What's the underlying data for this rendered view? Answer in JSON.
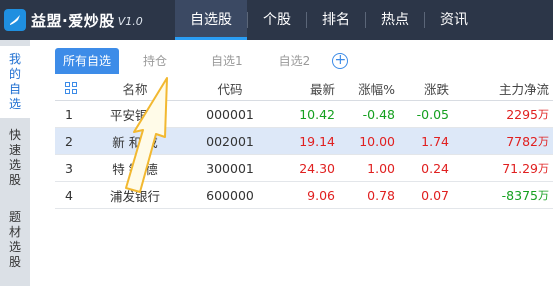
{
  "app": {
    "name": "益盟·爱炒股",
    "version": "V1.0"
  },
  "top_nav": [
    {
      "label": "自选股",
      "active": true
    },
    {
      "label": "个股",
      "active": false
    },
    {
      "label": "排名",
      "active": false
    },
    {
      "label": "热点",
      "active": false
    },
    {
      "label": "资讯",
      "active": false
    }
  ],
  "sidebar": [
    {
      "chars": [
        "我",
        "的",
        "自",
        "选"
      ],
      "active": true
    },
    {
      "chars": [
        "快",
        "速",
        "选",
        "股"
      ],
      "active": false
    },
    {
      "chars": [
        "题",
        "材",
        "选",
        "股"
      ],
      "active": false
    }
  ],
  "tabs": [
    {
      "label": "所有自选",
      "active": true
    },
    {
      "label": "持仓",
      "active": false
    },
    {
      "label": "自选1",
      "active": false
    },
    {
      "label": "自选2",
      "active": false
    }
  ],
  "add_tab_icon": "plus-circle-icon",
  "table": {
    "columns": [
      "名称",
      "代码",
      "最新",
      "涨幅%",
      "涨跌",
      "主力净流"
    ],
    "rows": [
      {
        "idx": "1",
        "name": "平安银行",
        "code": "000001",
        "price": "10.42",
        "pct": "-0.48",
        "chg": "-0.05",
        "flow": "2295",
        "unit": "万",
        "dir": "down",
        "flow_dir": "up",
        "selected": false
      },
      {
        "idx": "2",
        "name": "新 和 成",
        "code": "002001",
        "price": "19.14",
        "pct": "10.00",
        "chg": "1.74",
        "flow": "7782",
        "unit": "万",
        "dir": "up",
        "flow_dir": "up",
        "selected": true
      },
      {
        "idx": "3",
        "name": "特 锐 德",
        "code": "300001",
        "price": "24.30",
        "pct": "1.00",
        "chg": "0.24",
        "flow": "71.29",
        "unit": "万",
        "dir": "up",
        "flow_dir": "up",
        "selected": false
      },
      {
        "idx": "4",
        "name": "浦发银行",
        "code": "600000",
        "price": "9.06",
        "pct": "0.78",
        "chg": "0.07",
        "flow": "-8375",
        "unit": "万",
        "dir": "up",
        "flow_dir": "down",
        "selected": false
      }
    ]
  },
  "colors": {
    "header_bg": "#2c3648",
    "accent": "#3d8ce8",
    "up": "#e02020",
    "down": "#16a020",
    "selected_row": "#dde8f8",
    "annotation_arrow": "#f2b830"
  }
}
